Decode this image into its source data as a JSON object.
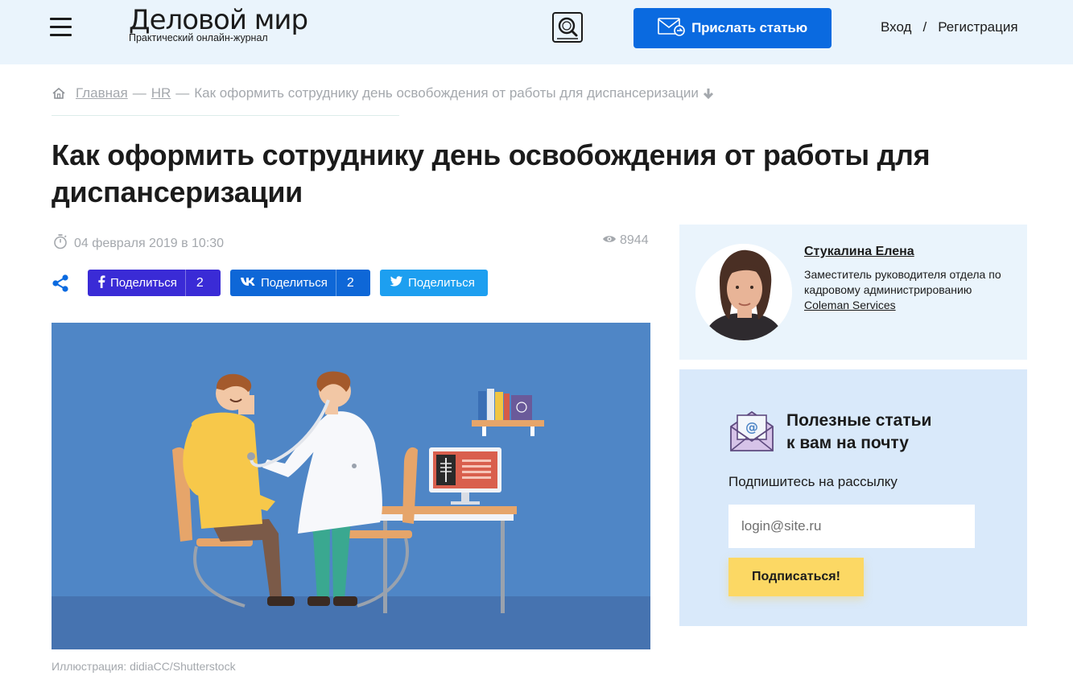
{
  "header": {
    "logo_title": "Деловой мир",
    "logo_subtitle": "Практический онлайн-журнал",
    "send_article_label": "Прислать статью",
    "login_label": "Вход",
    "auth_separator": "/",
    "register_label": "Регистрация"
  },
  "breadcrumb": {
    "home": "Главная",
    "sep1": "—",
    "section": "HR",
    "sep2": "—",
    "current": "Как оформить сотруднику день освобождения от работы для диспансеризации"
  },
  "article": {
    "title": "Как оформить сотруднику день освобождения от работы для диспансеризации",
    "date": "04 февраля 2019 в 10:30",
    "views": "8944",
    "caption": "Иллюстрация: didiaCC/Shutterstock"
  },
  "share": {
    "facebook_label": "Поделиться",
    "facebook_count": "2",
    "vk_label": "Поделиться",
    "vk_count": "2",
    "twitter_label": "Поделиться"
  },
  "author": {
    "name": "Стукалина Елена",
    "position": "Заместитель руководителя отдела по кадровому администрированию",
    "company": "Coleman Services"
  },
  "newsletter": {
    "title_line1": "Полезные статьи",
    "title_line2": "к вам на почту",
    "subtitle": "Подпишитесь на рассылку",
    "email_placeholder": "login@site.ru",
    "button_label": "Подписаться!"
  },
  "colors": {
    "header_bg": "#eaf4fc",
    "primary_button": "#0a6ae0",
    "facebook": "#3a2bd6",
    "vk": "#0e67d7",
    "twitter": "#1d9ff0",
    "subscribe_button": "#fcd864",
    "newsletter_bg": "#d9e9fa"
  },
  "icons": [
    "menu-icon",
    "search-icon",
    "envelope-icon",
    "home-icon",
    "arrow-down-icon",
    "stopwatch-icon",
    "eye-icon",
    "share-icon",
    "facebook-icon",
    "vk-icon",
    "twitter-icon",
    "mail-at-icon"
  ]
}
